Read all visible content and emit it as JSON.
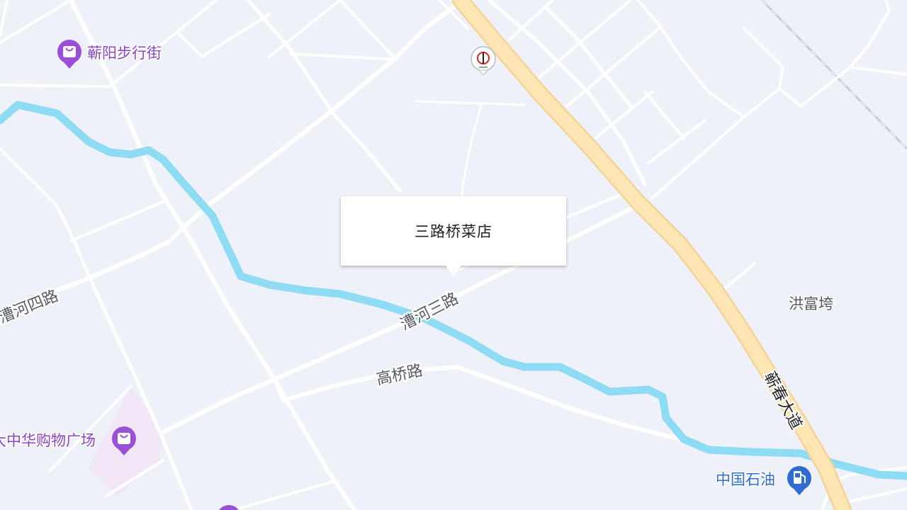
{
  "map": {
    "colors": {
      "background": "#eef1f8",
      "road": "#ffffff",
      "highway_fill": "#fde6b3",
      "highway_edge": "#f3d397",
      "river": "#8ddcf3",
      "railway": "#c9cbd1",
      "poi_purple": "#9b4fd6",
      "poi_blue": "#2f6bd1",
      "mall_area": "#f1e6f6"
    },
    "road_labels": {
      "caohe_san": "漕河三路",
      "caohe_si": "漕河四路",
      "gaoqiao": "高桥路",
      "qichun_dadao": "蕲春大道"
    },
    "area_labels": {
      "hongfuwan": "洪富垮"
    },
    "pois": {
      "qiyang_street": {
        "label": "蕲阳步行街",
        "icon": "shopping-bag-icon"
      },
      "zhonghua_mall": {
        "label": "大中华购物广场",
        "icon": "shopping-bag-icon"
      },
      "petrochina": {
        "label": "中国石油",
        "icon": "gas-station-icon"
      },
      "sinopec_marker": {
        "icon": "sinopec-logo-icon"
      },
      "bottom_partial": {
        "icon": "shopping-bag-icon"
      }
    }
  },
  "popup": {
    "title": "三路桥菜店"
  }
}
